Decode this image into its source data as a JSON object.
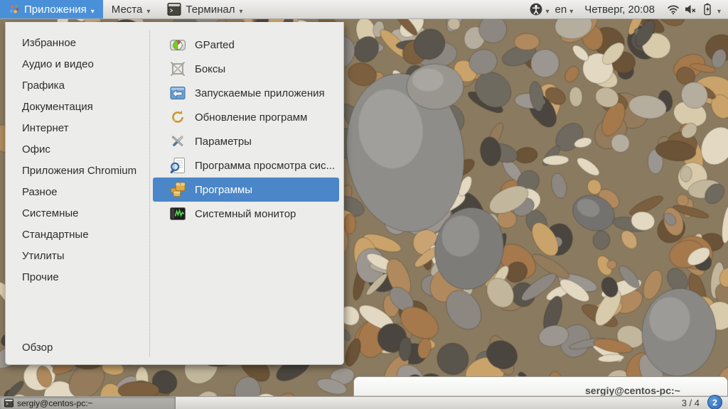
{
  "top_bar": {
    "applications_label": "Приложения",
    "places_label": "Места",
    "app_menu_label": "Терминал",
    "language_label": "en",
    "clock_label": "Четверг, 20:08",
    "status_icons": [
      "accessibility-icon",
      "wifi-icon",
      "volume-muted-icon",
      "battery-charging-icon"
    ]
  },
  "menu": {
    "categories": [
      "Избранное",
      "Аудио и видео",
      "Графика",
      "Документация",
      "Интернет",
      "Офис",
      "Приложения Chromium",
      "Разное",
      "Системные",
      "Стандартные",
      "Утилиты",
      "Прочие"
    ],
    "overview_label": "Обзор",
    "apps": [
      {
        "label": "GParted",
        "icon": "gparted-icon",
        "selected": false
      },
      {
        "label": "Боксы",
        "icon": "boxes-icon",
        "selected": false
      },
      {
        "label": "Запускаемые приложения",
        "icon": "startup-apps-icon",
        "selected": false
      },
      {
        "label": "Обновление программ",
        "icon": "software-update-icon",
        "selected": false
      },
      {
        "label": "Параметры",
        "icon": "settings-icon",
        "selected": false
      },
      {
        "label": "Программа просмотра сис...",
        "icon": "log-viewer-icon",
        "selected": false
      },
      {
        "label": "Программы",
        "icon": "software-packages-icon",
        "selected": true
      },
      {
        "label": "Системный монитор",
        "icon": "system-monitor-icon",
        "selected": false
      }
    ]
  },
  "window_peek": {
    "title": "sergiy@centos-pc:~"
  },
  "taskbar": {
    "window_button_label": "sergiy@centos-pc:~",
    "window_button_icon": "terminal-icon",
    "workspace_indicator": "3 / 4",
    "notification_count": "2"
  },
  "colors": {
    "panel_active_blue": "#4a90d9",
    "selection_blue": "#4a86c8",
    "menu_background": "#ececea",
    "notification_blue": "#2a68b4"
  }
}
